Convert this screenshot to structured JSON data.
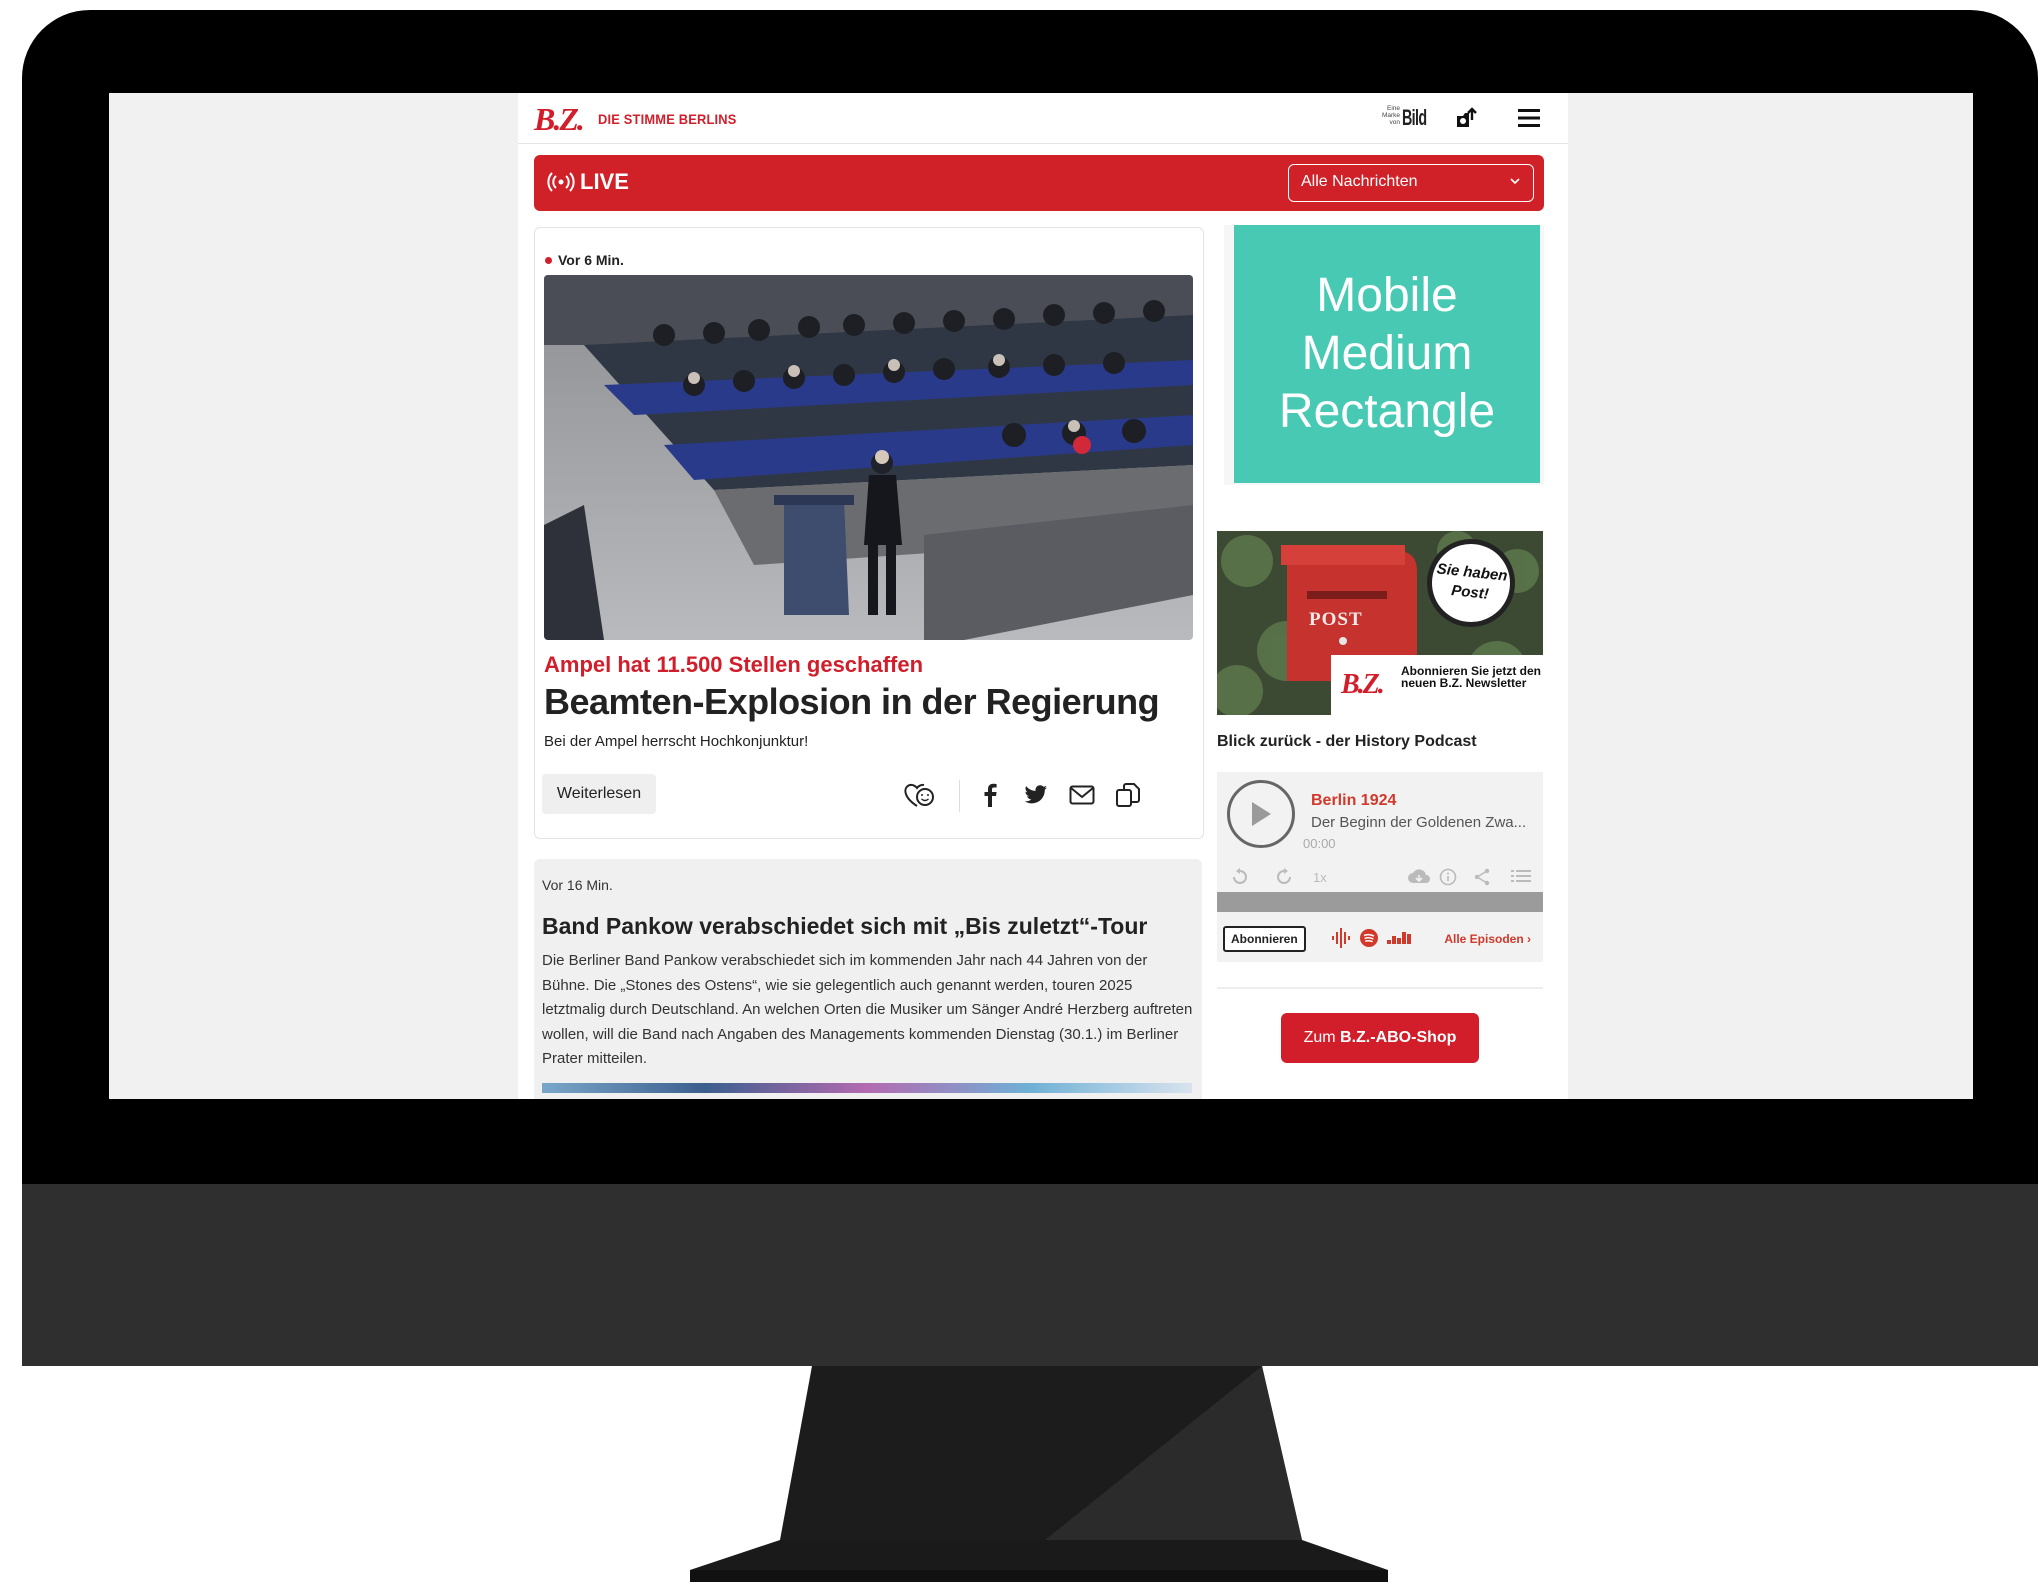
{
  "site": {
    "logo": "B.Z.",
    "slogan": "DIE STIMME BERLINS",
    "brand_small": "Eine Marke von",
    "brand_word": "Bild",
    "icons": {
      "share": "share-icon",
      "menu": "menu-icon"
    }
  },
  "live": {
    "label": "LIVE",
    "filter_selected": "Alle Nachrichten"
  },
  "article1": {
    "time": "Vor 6 Min.",
    "kicker": "Ampel hat 11.500 Stellen geschaffen",
    "headline": "Beamten-Explosion in der Regierung",
    "teaser": "Bei der Ampel herrscht Hochkonjunktur!",
    "read_more": "Weiterlesen",
    "share_icons": [
      "reaction-icon",
      "facebook-icon",
      "twitter-icon",
      "mail-icon",
      "copy-icon"
    ]
  },
  "article2": {
    "time": "Vor 16 Min.",
    "title": "Band Pankow verabschiedet sich mit „Bis zuletzt“-Tour",
    "body": "Die Berliner Band Pankow verabschiedet sich im kommenden Jahr nach 44 Jahren von der Bühne. Die „Stones des Ostens“, wie sie gelegentlich auch genannt werden, touren 2025 letztmalig durch Deutschland. An welchen Orten die Musiker um Sänger André Herzberg auftreten wollen, will die Band nach Angaben des Managements kommenden Dienstag (30.1.) im Berliner Prater mitteilen."
  },
  "ad": {
    "line1": "Mobile",
    "line2": "Medium",
    "line3": "Rectangle"
  },
  "newsletter": {
    "badge_line1": "Sie haben",
    "badge_line2": "Post!",
    "post_label": "POST",
    "logo": "B.Z.",
    "text": "Abonnieren Sie jetzt den neuen B.Z. Newsletter"
  },
  "podcast": {
    "section_title": "Blick zurück - der History Podcast",
    "episode_title": "Berlin 1924",
    "episode_desc": "Der Beginn der Goldenen Zwa...",
    "time": "00:00",
    "speed": "1x",
    "progress": 0,
    "subscribe": "Abonnieren",
    "all_episodes": "Alle Episoden ›",
    "platform_icons": [
      "podcast-icon",
      "spotify-icon",
      "deezer-icon"
    ]
  },
  "shop": {
    "prefix": "Zum ",
    "bold": "B.Z.-ABO-Shop"
  },
  "colors": {
    "brand_red": "#d11e2a",
    "ad_teal": "#48c9b4",
    "monitor_bezel": "#000000",
    "monitor_chin": "#2f2f2f"
  }
}
